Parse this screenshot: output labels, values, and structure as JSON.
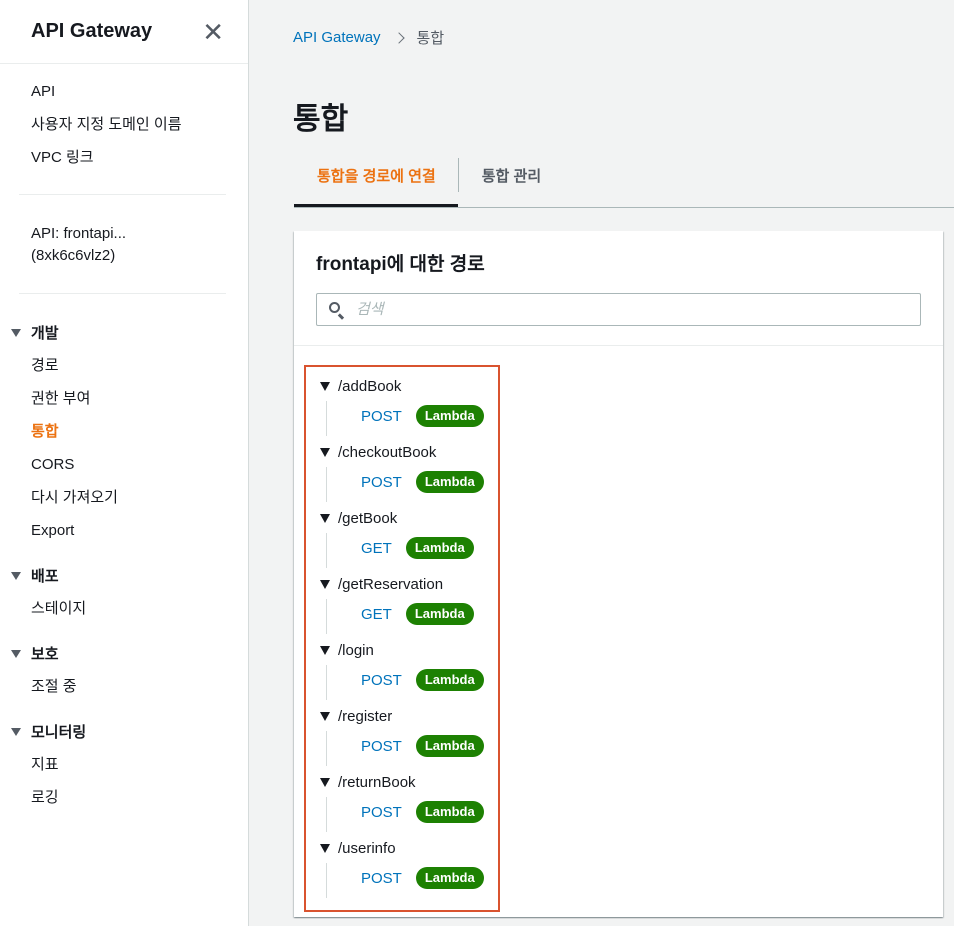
{
  "sidebar": {
    "title": "API Gateway",
    "top_links": [
      "API",
      "사용자 지정 도메인 이름",
      "VPC 링크"
    ],
    "api_label_line1": "API: frontapi...",
    "api_label_line2": "(8xk6c6vlz2)",
    "groups": [
      {
        "label": "개발",
        "items": [
          "경로",
          "권한 부여",
          "통합",
          "CORS",
          "다시 가져오기",
          "Export"
        ]
      },
      {
        "label": "배포",
        "items": [
          "스테이지"
        ]
      },
      {
        "label": "보호",
        "items": [
          "조절 중"
        ]
      },
      {
        "label": "모니터링",
        "items": [
          "지표",
          "로깅"
        ]
      }
    ],
    "active_item": "통합"
  },
  "breadcrumb": {
    "root": "API Gateway",
    "current": "통합"
  },
  "page_title": "통합",
  "tabs": [
    {
      "label": "통합을 경로에 연결",
      "active": true
    },
    {
      "label": "통합 관리",
      "active": false
    }
  ],
  "panel": {
    "title": "frontapi에 대한 경로",
    "search_placeholder": "검색"
  },
  "routes": [
    {
      "path": "/addBook",
      "method": "POST",
      "integration": "Lambda"
    },
    {
      "path": "/checkoutBook",
      "method": "POST",
      "integration": "Lambda"
    },
    {
      "path": "/getBook",
      "method": "GET",
      "integration": "Lambda"
    },
    {
      "path": "/getReservation",
      "method": "GET",
      "integration": "Lambda"
    },
    {
      "path": "/login",
      "method": "POST",
      "integration": "Lambda"
    },
    {
      "path": "/register",
      "method": "POST",
      "integration": "Lambda"
    },
    {
      "path": "/returnBook",
      "method": "POST",
      "integration": "Lambda"
    },
    {
      "path": "/userinfo",
      "method": "POST",
      "integration": "Lambda"
    }
  ],
  "colors": {
    "accent": "#ec7211",
    "link": "#0073bb",
    "badge": "#1d8102",
    "highlight_border": "#d9532f"
  }
}
